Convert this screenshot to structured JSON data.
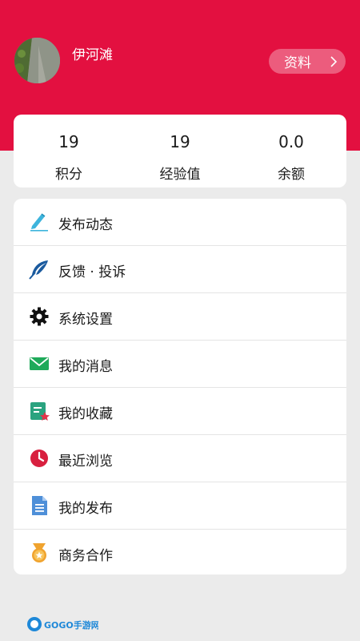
{
  "profile": {
    "username": "伊河滩",
    "profile_button_label": "资料"
  },
  "stats": [
    {
      "value": "19",
      "label": "积分"
    },
    {
      "value": "19",
      "label": "经验值"
    },
    {
      "value": "0.0",
      "label": "余额"
    }
  ],
  "menu": [
    {
      "label": "发布动态",
      "icon": "pen-icon"
    },
    {
      "label": "反馈 · 投诉",
      "icon": "feather-icon"
    },
    {
      "label": "系统设置",
      "icon": "gear-icon"
    },
    {
      "label": "我的消息",
      "icon": "mail-icon"
    },
    {
      "label": "我的收藏",
      "icon": "bookmark-star-icon"
    },
    {
      "label": "最近浏览",
      "icon": "clock-icon"
    },
    {
      "label": "我的发布",
      "icon": "document-icon"
    },
    {
      "label": "商务合作",
      "icon": "medal-icon"
    }
  ],
  "watermark": {
    "text": "GOGO手游网"
  },
  "colors": {
    "header_bg": "#e31040",
    "page_bg": "#ebebeb"
  }
}
